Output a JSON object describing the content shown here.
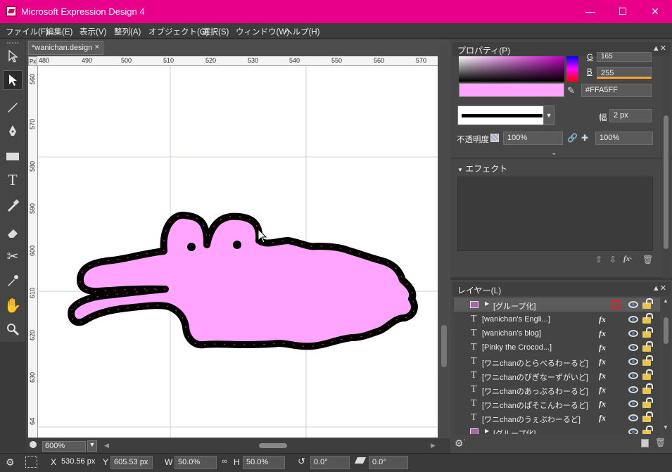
{
  "window": {
    "title": "Microsoft Expression Design 4"
  },
  "menu": [
    "ファイル(F)",
    "編集(E)",
    "表示(V)",
    "整列(A)",
    "オブジェクト(O)",
    "選択(S)",
    "ウィンドウ(W)",
    "ヘルプ(H)"
  ],
  "document": {
    "tab_label": "*wanichan.design",
    "ruler_unit": "Px",
    "ruler_h": [
      "480",
      "490",
      "500",
      "510",
      "520",
      "530",
      "540",
      "550",
      "560",
      "570"
    ],
    "ruler_v": [
      "560",
      "570",
      "580",
      "590",
      "600",
      "610",
      "620",
      "630",
      "64"
    ],
    "zoom": "600%",
    "shape_fill": "#FFA5FF",
    "shape_stroke": "#000000",
    "path_color": "#e03030"
  },
  "properties": {
    "header": "プロパティ(P)",
    "g_label": "G",
    "g_value": "165",
    "b_label": "B",
    "b_value": "255",
    "hex": "#FFA5FF",
    "width_label": "幅",
    "width_value": "2 px",
    "opacity_label": "不透明度",
    "opacity_fill": "100%",
    "opacity_stroke": "100%"
  },
  "effects": {
    "header": "エフェクト"
  },
  "layers": {
    "header": "レイヤー(L)",
    "rows": [
      {
        "kind": "group",
        "name": "[グループ化]"
      },
      {
        "kind": "text",
        "name": "[wanichan's Engli...]",
        "fx": "fx"
      },
      {
        "kind": "text",
        "name": "[wanichan's blog]",
        "fx": "fx"
      },
      {
        "kind": "text",
        "name": "[Pinky the Crocod...]",
        "fx": "fx"
      },
      {
        "kind": "text",
        "name": "[ワニchanのとらべるわーるど]",
        "fx": "fx"
      },
      {
        "kind": "text",
        "name": "[ワニchanのびぎなーずがいど]",
        "fx": "fx"
      },
      {
        "kind": "text",
        "name": "[ワニchanのあっぷるわーるど]",
        "fx": "fx"
      },
      {
        "kind": "text",
        "name": "[ワニchanのぱそこんわーるど]",
        "fx": "fx"
      },
      {
        "kind": "text",
        "name": "[ワニchanのうぇぶわーるど]",
        "fx": "fx"
      },
      {
        "kind": "group",
        "name": "[グループ化]"
      }
    ]
  },
  "status": {
    "x_label": "X",
    "x_value": "530.56 px",
    "y_label": "Y",
    "y_value": "605.53 px",
    "w_label": "W",
    "w_value": "50.0%",
    "h_label": "H",
    "h_value": "50.0%",
    "rotate_value": "0.0°",
    "skew_value": "0.0°"
  },
  "icons": {
    "selection": "arrow-icon",
    "direct-select": "direct-select-icon",
    "brush": "brush-icon",
    "pen": "pen-icon",
    "rectangle": "rectangle-icon",
    "text": "text-icon",
    "eyedropper": "eyedropper-icon",
    "eraser": "eraser-icon",
    "scissors": "scissors-icon",
    "hand": "hand-icon",
    "zoom": "zoom-icon"
  }
}
